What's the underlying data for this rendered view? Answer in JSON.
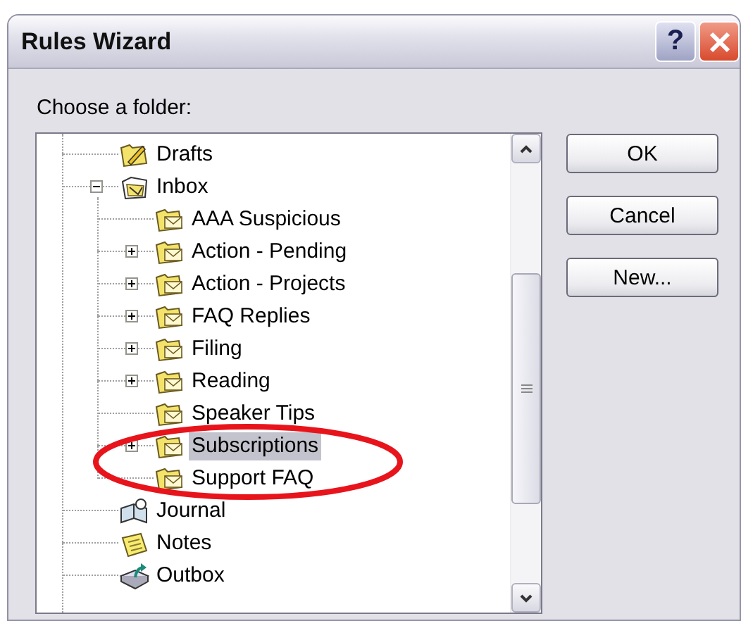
{
  "window": {
    "title": "Rules Wizard",
    "controls": [
      {
        "kind": "help",
        "label": "?"
      },
      {
        "kind": "close"
      }
    ]
  },
  "prompt": "Choose a folder:",
  "tree": {
    "items": [
      {
        "label": "Drafts",
        "kind": "drafts",
        "expandable": false,
        "selected": false
      },
      {
        "label": "Inbox",
        "kind": "inbox",
        "expandable": true,
        "expanded": true,
        "selected": false,
        "children": [
          {
            "label": "AAA Suspicious",
            "kind": "folder",
            "expandable": false,
            "selected": false
          },
          {
            "label": "Action - Pending",
            "kind": "folder",
            "expandable": true,
            "expanded": false,
            "selected": false
          },
          {
            "label": "Action - Projects",
            "kind": "folder",
            "expandable": true,
            "expanded": false,
            "selected": false
          },
          {
            "label": "FAQ Replies",
            "kind": "folder",
            "expandable": true,
            "expanded": false,
            "selected": false
          },
          {
            "label": "Filing",
            "kind": "folder",
            "expandable": true,
            "expanded": false,
            "selected": false
          },
          {
            "label": "Reading",
            "kind": "folder",
            "expandable": true,
            "expanded": false,
            "selected": false
          },
          {
            "label": "Speaker Tips",
            "kind": "folder",
            "expandable": false,
            "selected": false
          },
          {
            "label": "Subscriptions",
            "kind": "folder",
            "expandable": true,
            "expanded": false,
            "selected": true
          },
          {
            "label": "Support FAQ",
            "kind": "folder",
            "expandable": false,
            "selected": false
          }
        ]
      },
      {
        "label": "Journal",
        "kind": "journal",
        "expandable": false,
        "selected": false
      },
      {
        "label": "Notes",
        "kind": "notes",
        "expandable": false,
        "selected": false
      },
      {
        "label": "Outbox",
        "kind": "outbox",
        "expandable": false,
        "selected": false
      }
    ]
  },
  "buttons": [
    {
      "label": "OK"
    },
    {
      "label": "Cancel"
    },
    {
      "label": "New..."
    }
  ],
  "annotations": [
    {
      "kind": "ellipse"
    }
  ]
}
